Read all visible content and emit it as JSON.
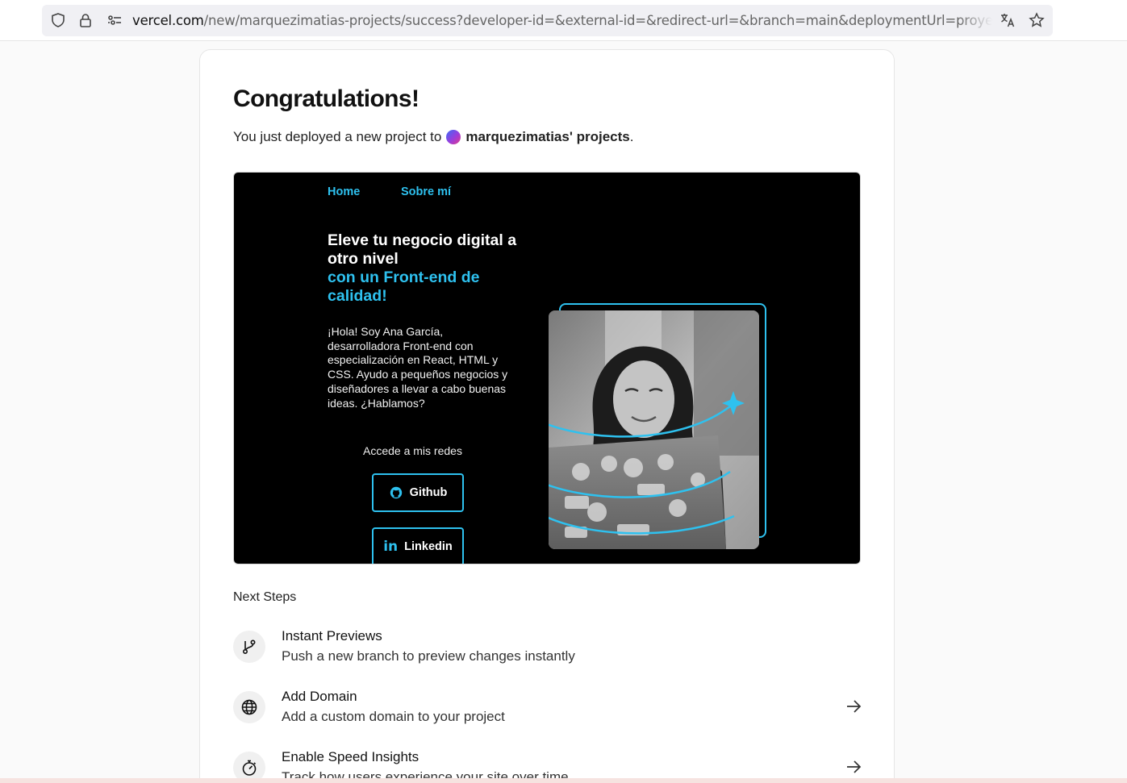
{
  "browser": {
    "url_host": "vercel.com",
    "url_path": "/new/marquezimatias-projects/success?developer-id=&external-id=&redirect-url=&branch=main&deploymentUrl=proyecto-htm",
    "icons": [
      "shield-icon",
      "lock-icon",
      "permissions-icon",
      "translate-icon",
      "star-icon"
    ]
  },
  "card": {
    "title": "Congratulations!",
    "subtitle_prefix": "You just deployed a new project to",
    "team_name": "marquezimatias' projects",
    "subtitle_suffix": "."
  },
  "preview": {
    "nav": [
      "Home",
      "Sobre mí"
    ],
    "headline_white": "Eleve tu negocio digital a otro nivel",
    "headline_accent": "con un Front-end de calidad!",
    "intro": "¡Hola! Soy Ana García, desarrolladora Front-end con especialización en React, HTML y CSS. Ayudo a pequeños negocios y diseñadores a llevar a cabo buenas ideas. ¿Hablamos?",
    "social_label": "Accede a mis redes",
    "buttons": [
      {
        "label": "Github",
        "icon": "github-icon"
      },
      {
        "label": "Linkedin",
        "icon": "linkedin-icon"
      }
    ],
    "accent_color": "#2ec1ef"
  },
  "next_steps": {
    "label": "Next Steps",
    "items": [
      {
        "title": "Instant Previews",
        "desc": "Push a new branch to preview changes instantly",
        "icon": "git-branch-icon",
        "has_arrow": false
      },
      {
        "title": "Add Domain",
        "desc": "Add a custom domain to your project",
        "icon": "globe-icon",
        "has_arrow": true
      },
      {
        "title": "Enable Speed Insights",
        "desc": "Track how users experience your site over time",
        "icon": "speed-gauge-icon",
        "has_arrow": true
      }
    ]
  }
}
